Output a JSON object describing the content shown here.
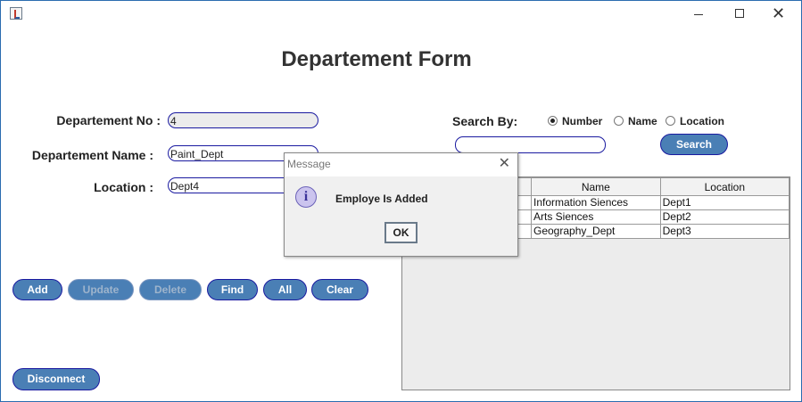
{
  "window": {
    "title": ""
  },
  "form": {
    "title": "Departement Form",
    "dept_no_label": "Departement No :",
    "dept_no_value": "4",
    "dept_name_label": "Departement Name :",
    "dept_name_value": "Paint_Dept",
    "location_label": "Location :",
    "location_value": "Dept4"
  },
  "search": {
    "label": "Search By:",
    "options": [
      "Number",
      "Name",
      "Location"
    ],
    "selected": "Number",
    "input_value": "",
    "button_label": "Search"
  },
  "actions": {
    "add": "Add",
    "update": "Update",
    "delete": "Delete",
    "find": "Find",
    "all": "All",
    "clear": "Clear",
    "disconnect": "Disconnect"
  },
  "table": {
    "columns": [
      "",
      "Name",
      "Location"
    ],
    "rows": [
      [
        "",
        "Information Siences",
        "Dept1"
      ],
      [
        "",
        "Arts Siences",
        "Dept2"
      ],
      [
        "",
        "Geography_Dept",
        "Dept3"
      ]
    ]
  },
  "dialog": {
    "title": "Message",
    "message": "Employe Is Added",
    "ok_label": "OK",
    "icon": "info-icon"
  },
  "colors": {
    "button_fill": "#4a7fb5",
    "button_border": "#1a1aa0"
  }
}
